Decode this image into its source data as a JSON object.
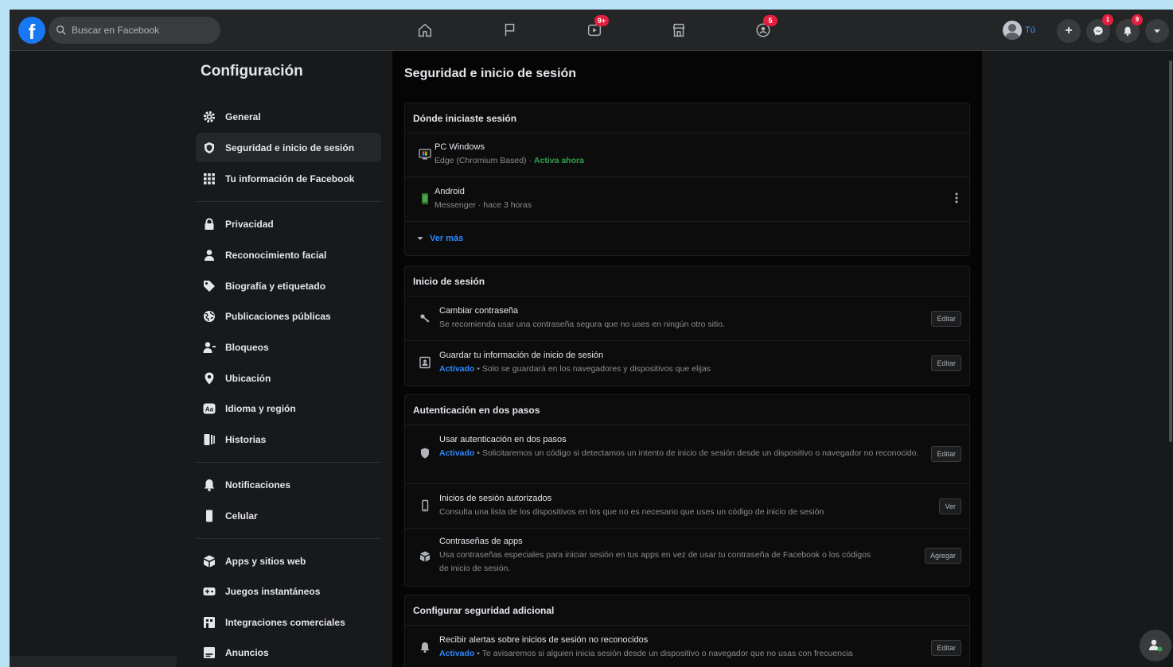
{
  "topbar": {
    "logo": "f",
    "search_placeholder": "Buscar en Facebook",
    "nav": [
      {
        "name": "home-icon",
        "badge": ""
      },
      {
        "name": "pages-flag-icon",
        "badge": ""
      },
      {
        "name": "watch-icon",
        "badge": "9+"
      },
      {
        "name": "marketplace-icon",
        "badge": ""
      },
      {
        "name": "groups-icon",
        "badge": "5"
      }
    ],
    "profile_label": "Tú",
    "create_label": "+",
    "messenger_badge": "1",
    "notifications_badge": "9"
  },
  "sidebar": {
    "title": "Configuración",
    "items": [
      {
        "label": "General",
        "icon": "gear-icon"
      },
      {
        "label": "Seguridad e inicio de sesión",
        "icon": "shield-icon"
      },
      {
        "label": "Tu información de Facebook",
        "icon": "grid-icon"
      },
      {
        "label": "Privacidad",
        "icon": "lock-icon"
      },
      {
        "label": "Reconocimiento facial",
        "icon": "person-icon"
      },
      {
        "label": "Biografía y etiquetado",
        "icon": "tag-icon"
      },
      {
        "label": "Publicaciones públicas",
        "icon": "globe-icon"
      },
      {
        "label": "Bloqueos",
        "icon": "block-user-icon"
      },
      {
        "label": "Ubicación",
        "icon": "location-pin-icon"
      },
      {
        "label": "Idioma y región",
        "icon": "language-icon"
      },
      {
        "label": "Historias",
        "icon": "book-icon"
      },
      {
        "label": "Notificaciones",
        "icon": "bell-icon"
      },
      {
        "label": "Celular",
        "icon": "phone-icon"
      },
      {
        "label": "Apps y sitios web",
        "icon": "apps-icon"
      },
      {
        "label": "Juegos instantáneos",
        "icon": "game-icon"
      },
      {
        "label": "Integraciones comerciales",
        "icon": "business-icon"
      },
      {
        "label": "Anuncios",
        "icon": "ads-icon"
      }
    ]
  },
  "main": {
    "title": "Seguridad e inicio de sesión",
    "where": {
      "heading": "Dónde iniciaste sesión",
      "sessions": [
        {
          "device": "PC Windows",
          "detail": "Edge (Chromium Based) · ",
          "status": "Activa ahora"
        },
        {
          "device": "Android",
          "detail": "Messenger · hace 3 horas",
          "status": ""
        }
      ],
      "more_label": "Ver más"
    },
    "login": {
      "heading": "Inicio de sesión",
      "rows": [
        {
          "title": "Cambiar contraseña",
          "prefix": "",
          "desc": "Se recomienda usar una contraseña segura que no uses en ningún otro sitio.",
          "button": "Editar"
        },
        {
          "title": "Guardar tu información de inicio de sesión",
          "prefix": "Activado",
          "desc": " • Solo se guardará en los navegadores y dispositivos que elijas",
          "button": "Editar"
        }
      ]
    },
    "twofa": {
      "heading": "Autenticación en dos pasos",
      "rows": [
        {
          "title": "Usar autenticación en dos pasos",
          "prefix": "Activado",
          "desc": " • Solicitaremos un código si detectamos un intento de inicio de sesión desde un dispositivo o navegador no reconocido.",
          "button": "Editar"
        },
        {
          "title": "Inicios de sesión autorizados",
          "prefix": "",
          "desc": "Consulta una lista de los dispositivos en los que no es necesario que uses un código de inicio de sesión",
          "button": "Ver"
        },
        {
          "title": "Contraseñas de apps",
          "prefix": "",
          "desc": "Usa contraseñas especiales para iniciar sesión en tus apps en vez de usar tu contraseña de Facebook o los códigos de inicio de sesión.",
          "button": "Agregar"
        }
      ]
    },
    "extra": {
      "heading": "Configurar seguridad adicional",
      "rows": [
        {
          "title": "Recibir alertas sobre inicios de sesión no reconocidos",
          "prefix": "Activado",
          "desc": " • Te avisaremos si alguien inicia sesión desde un dispositivo o navegador que no usas con frecuencia",
          "button": "Editar"
        }
      ]
    }
  },
  "colors": {
    "accent": "#2d88ff",
    "active": "#31a24c",
    "badge": "#e41e3f",
    "brand": "#1877f2"
  }
}
